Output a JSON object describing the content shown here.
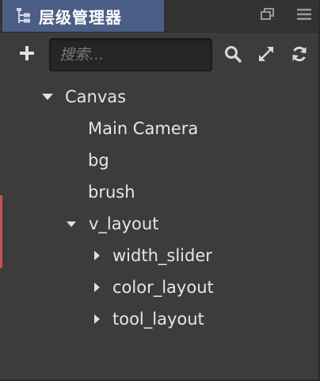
{
  "window": {
    "tab_title": "层级管理器",
    "tab_icon": "hierarchy-icon",
    "restore_icon": "restore-window-icon",
    "menu_icon": "hamburger-menu-icon"
  },
  "toolbar": {
    "add_icon": "plus-icon",
    "search_placeholder": "搜索...",
    "search_value": "",
    "search_icon": "magnifier-icon",
    "expand_icon": "expand-arrows-icon",
    "refresh_icon": "refresh-icon"
  },
  "tree": [
    {
      "label": "Canvas",
      "depth": 0,
      "expander": "expanded"
    },
    {
      "label": "Main Camera",
      "depth": 1,
      "expander": "none"
    },
    {
      "label": "bg",
      "depth": 1,
      "expander": "none"
    },
    {
      "label": "brush",
      "depth": 1,
      "expander": "none"
    },
    {
      "label": "v_layout",
      "depth": 1,
      "expander": "expanded"
    },
    {
      "label": "width_slider",
      "depth": 2,
      "expander": "collapsed"
    },
    {
      "label": "color_layout",
      "depth": 2,
      "expander": "collapsed"
    },
    {
      "label": "tool_layout",
      "depth": 2,
      "expander": "collapsed"
    }
  ],
  "colors": {
    "panel_bg": "#3c3c3c",
    "tab_active_bg": "#4a5e86",
    "text": "#e6e6e6",
    "search_bg": "#252525"
  }
}
